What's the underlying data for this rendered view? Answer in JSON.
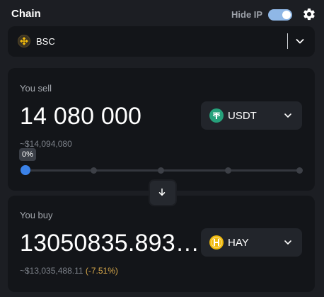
{
  "header": {
    "title": "Chain",
    "hide_ip_label": "Hide IP",
    "hide_ip_enabled": true
  },
  "chain": {
    "selected": "BSC",
    "icon": "bsc-icon"
  },
  "sell": {
    "label": "You sell",
    "amount": "14 080 000",
    "usd_value": "~$14,094,080",
    "token": "USDT",
    "token_icon": "usdt-icon",
    "percent_label": "0%",
    "percent_value": 0
  },
  "buy": {
    "label": "You buy",
    "amount": "13050835.893…",
    "usd_value": "~$13,035,488.11",
    "price_impact": "(-7.51%)",
    "token": "HAY",
    "token_icon": "hay-icon"
  },
  "colors": {
    "accent": "#3b82e8",
    "usdt": "#26a17b",
    "hay": "#f0b90b",
    "warning": "#d6a74a"
  }
}
